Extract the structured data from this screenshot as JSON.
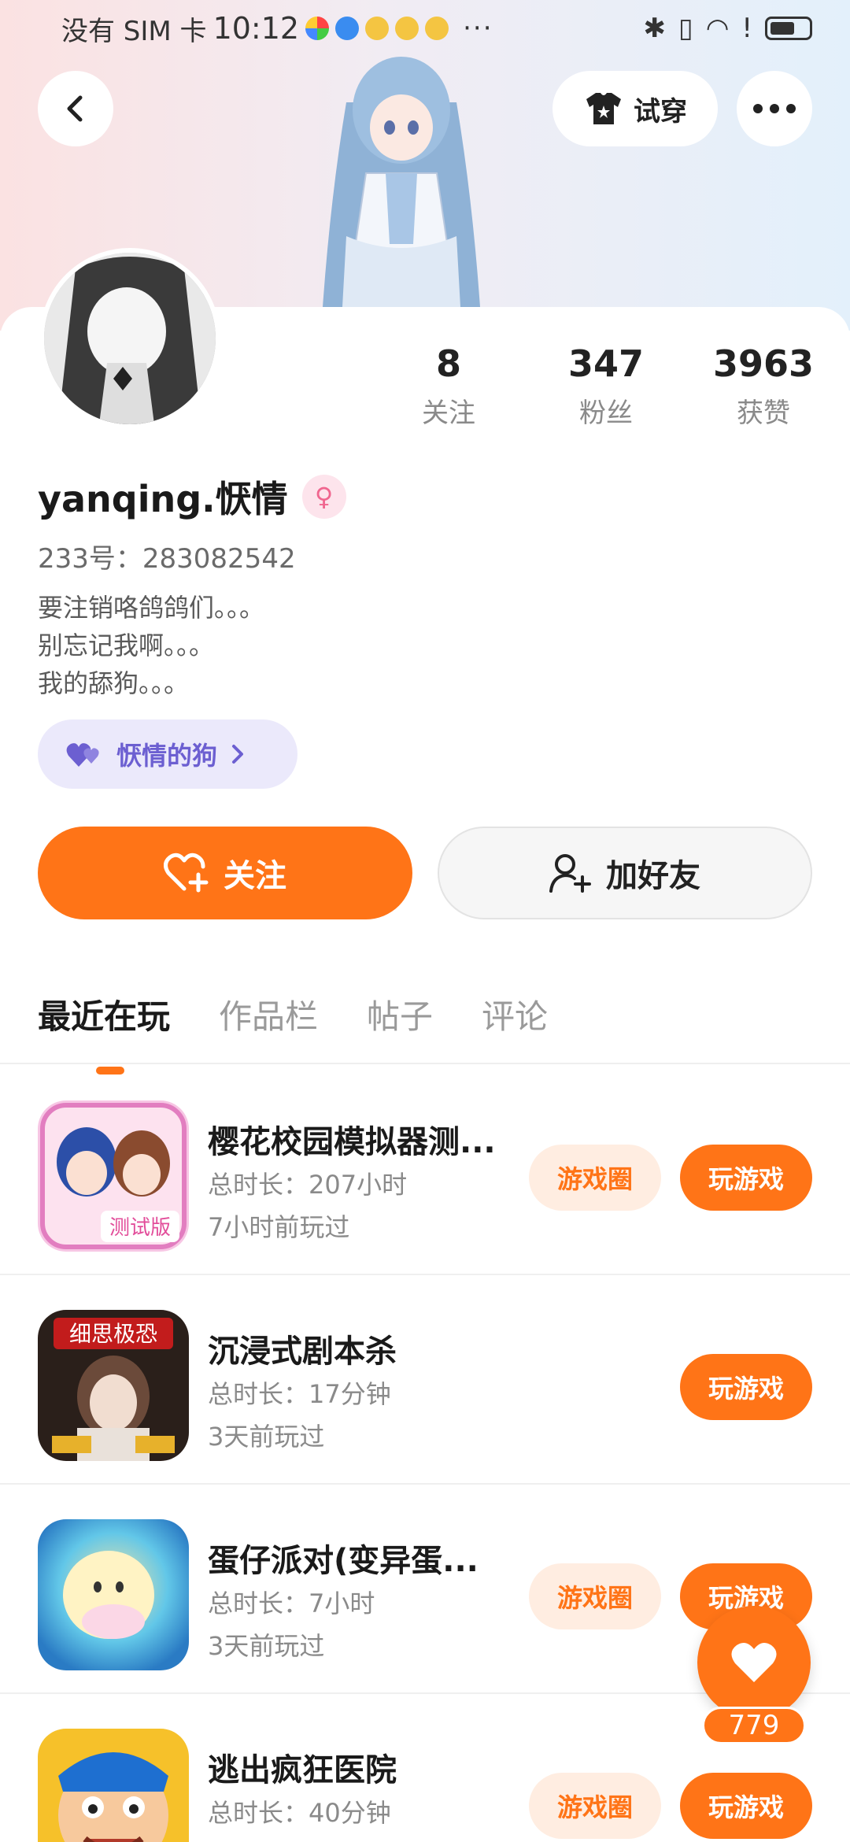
{
  "status_bar": {
    "carrier": "没有 SIM 卡",
    "time": "10:12",
    "more": "···"
  },
  "header": {
    "try_on_label": "试穿"
  },
  "profile": {
    "stats": [
      {
        "value": "8",
        "label": "关注"
      },
      {
        "value": "347",
        "label": "粉丝"
      },
      {
        "value": "3963",
        "label": "获赞"
      }
    ],
    "username": "yanqing.恹情",
    "account_id": "233号：283082542",
    "bio_lines": [
      "要注销咯鸽鸽们。。。",
      "别忘记我啊。。。",
      "我的舔狗。。。"
    ],
    "tag_label": "恹情的狗"
  },
  "actions": {
    "follow_label": "关注",
    "add_friend_label": "加好友"
  },
  "tabs": [
    "最近在玩",
    "作品栏",
    "帖子",
    "评论"
  ],
  "games": [
    {
      "title": "樱花校园模拟器测...",
      "duration": "总时长：207小时",
      "last_played": "7小时前玩过",
      "circle_label": "游戏圈",
      "play_label": "玩游戏"
    },
    {
      "title": "沉浸式剧本杀",
      "duration": "总时长：17分钟",
      "last_played": "3天前玩过",
      "play_label": "玩游戏"
    },
    {
      "title": "蛋仔派对(变异蛋...",
      "duration": "总时长：7小时",
      "last_played": "3天前玩过",
      "circle_label": "游戏圈",
      "play_label": "玩游戏"
    },
    {
      "title": "逃出疯狂医院",
      "duration": "总时长：40分钟",
      "last_played": "",
      "circle_label": "游戏圈",
      "play_label": "玩游戏"
    }
  ],
  "floating_like": {
    "count": "779"
  },
  "colors": {
    "accent": "#ff7417",
    "tag_bg": "#ebe9fb",
    "tag_text": "#6c5fd1"
  }
}
